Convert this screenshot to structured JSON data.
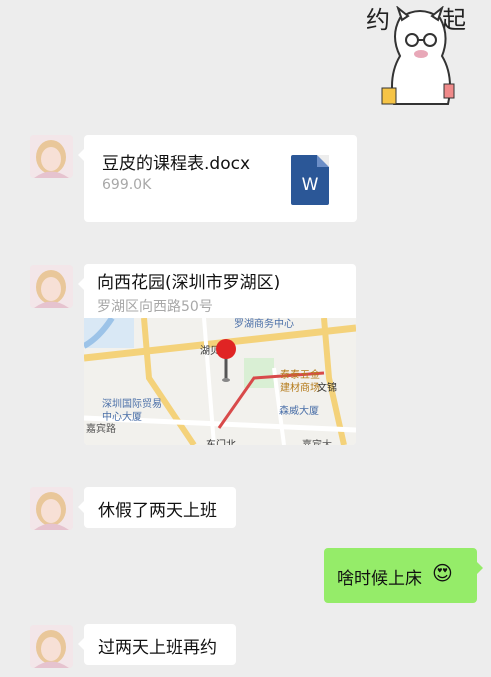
{
  "sticker": {
    "text_left": "约",
    "text_right": "起"
  },
  "messages": {
    "file": {
      "name": "豆皮的课程表.docx",
      "size": "699.0K",
      "icon_letter": "W"
    },
    "location": {
      "title": "向西花园(深圳市罗湖区)",
      "address": "罗湖区向西路50号",
      "map_labels": {
        "top": "罗湖商务中心",
        "hubei": "湖贝",
        "taitai": "泰泰五金",
        "taitai2": "建材商场",
        "wenjin": "文锦",
        "shenzhen_itc": "深圳国际贸易",
        "center": "中心大厦",
        "senwei": "森威大厦",
        "jiabin": "嘉宾路",
        "bottom": "东门北",
        "bottom2": "嘉宾大"
      }
    },
    "text1": "休假了两天上班",
    "self_text": "啥时候上床",
    "self_emoji": "😍",
    "text2": "过两天上班再约"
  },
  "colors": {
    "self_bubble": "#95ec69",
    "background": "#ededed",
    "word_blue": "#2b5797"
  }
}
